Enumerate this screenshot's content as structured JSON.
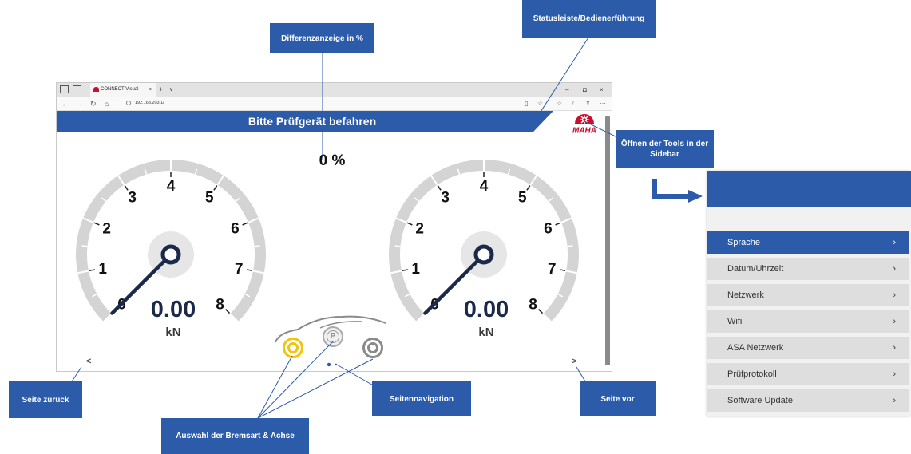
{
  "browser": {
    "tab_title": "CONNECT Visual",
    "tab_close": "×",
    "new_tab": "+",
    "tab_dropdown": "∨",
    "window_controls": {
      "minimize": "–",
      "maximize": "◘",
      "close": "×"
    },
    "nav": {
      "back": "←",
      "forward": "→",
      "reload": "↻",
      "home": "⌂"
    },
    "url": "192.168.203.1/",
    "toolbar_icons": [
      "reading-view-icon",
      "favorite-star-icon",
      "favorites-icon",
      "pen-icon",
      "share-icon",
      "more-icon"
    ],
    "toolbar_glyphs": {
      "reading": "▯",
      "star": "☆",
      "favorites": "☆",
      "pen": "ℓ",
      "share": "⇪",
      "more": "···"
    }
  },
  "app": {
    "status_text": "Bitte Prüfgerät befahren",
    "difference": "0 %",
    "logo_text": "MAHA",
    "gauges": [
      {
        "value": "0.00",
        "unit": "kN",
        "ticks": [
          "0",
          "1",
          "2",
          "3",
          "4",
          "5",
          "6",
          "7",
          "8"
        ]
      },
      {
        "value": "0.00",
        "unit": "kN",
        "ticks": [
          "0",
          "1",
          "2",
          "3",
          "4",
          "5",
          "6",
          "7",
          "8"
        ]
      }
    ],
    "axle_selection": [
      "brake-active-icon",
      "parking-brake-icon",
      "axle-icon"
    ],
    "parking_letter": "P",
    "page_prev": "<",
    "page_next": ">",
    "page_count": 2,
    "current_page": 1
  },
  "callouts": {
    "difference": "Differenzanzeige in %",
    "statusbar": "Statusleiste/Bedienerführung",
    "tools": "Öffnen der Tools in der Sidebar",
    "back": "Seite zurück",
    "page_nav": "Seitennavigation",
    "forward": "Seite vor",
    "brake_select": "Auswahl der Bremsart & Achse"
  },
  "sidebar": {
    "items": [
      {
        "label": "Sprache",
        "active": true
      },
      {
        "label": "Datum/Uhrzeit",
        "active": false
      },
      {
        "label": "Netzwerk",
        "active": false
      },
      {
        "label": "Wifi",
        "active": false
      },
      {
        "label": "ASA Netzwerk",
        "active": false
      },
      {
        "label": "Prüfprotokoll",
        "active": false
      },
      {
        "label": "Software Update",
        "active": false
      }
    ],
    "chevron": "›"
  },
  "colors": {
    "accent": "#2b5ba9",
    "gauge_track": "#d4d4d4",
    "needle": "#1b2a4a",
    "brand_red": "#c8102e",
    "active_axle": "#f2c40e"
  }
}
